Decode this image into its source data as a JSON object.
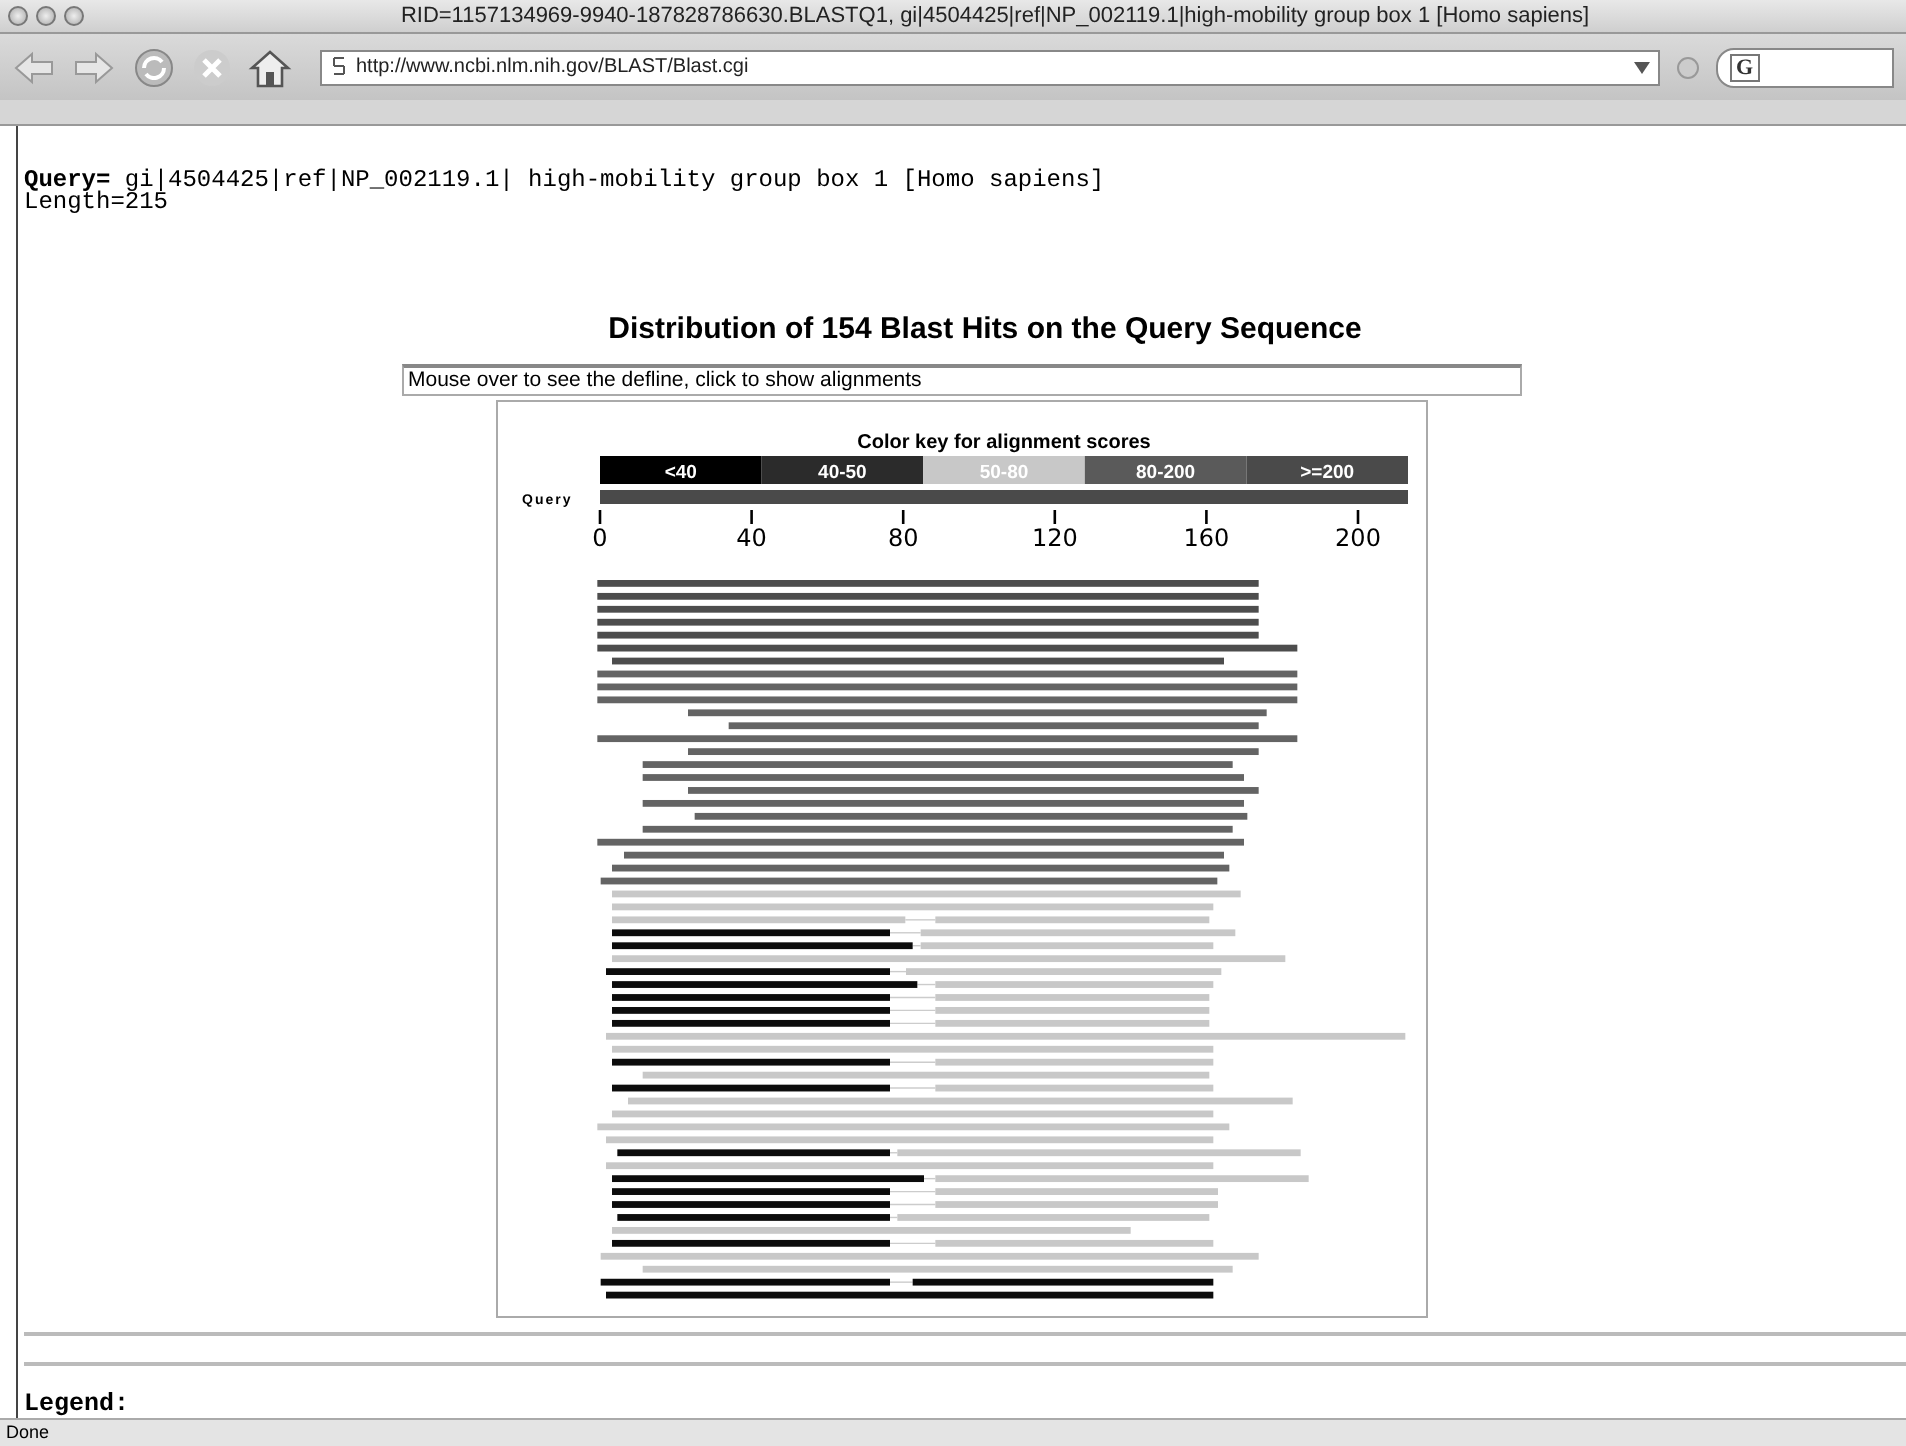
{
  "window": {
    "title": "RID=1157134969-9940-187828786630.BLASTQ1, gi|4504425|ref|NP_002119.1|high-mobility group box 1 [Homo sapiens]"
  },
  "toolbar": {
    "url": "http://www.ncbi.nlm.nih.gov/BLAST/Blast.cgi",
    "search_icon_label": "G"
  },
  "query": {
    "line": "**Query=** gi|4504425|ref|NP_002119.1| high-mobility group box 1 [Homo sapiens]",
    "length": "Length=215"
  },
  "heading": "Distribution of 154 Blast Hits on the Query Sequence",
  "defline_box": "Mouse over to see the defline, click to show alignments",
  "graphic": {
    "key_title": "Color key for alignment scores",
    "key": [
      {
        "label": "<40",
        "color": "#000000"
      },
      {
        "label": "40-50",
        "color": "#2b2b2b"
      },
      {
        "label": "50-80",
        "color": "#c8c8c8"
      },
      {
        "label": "80-200",
        "color": "#5a5a5a"
      },
      {
        "label": ">=200",
        "color": "#4a4a4a"
      }
    ],
    "query_label": "Query",
    "ticks": [
      "0",
      "40",
      "80",
      "120",
      "160",
      "200"
    ]
  },
  "legend": "Legend:",
  "status_bar": "Done"
}
